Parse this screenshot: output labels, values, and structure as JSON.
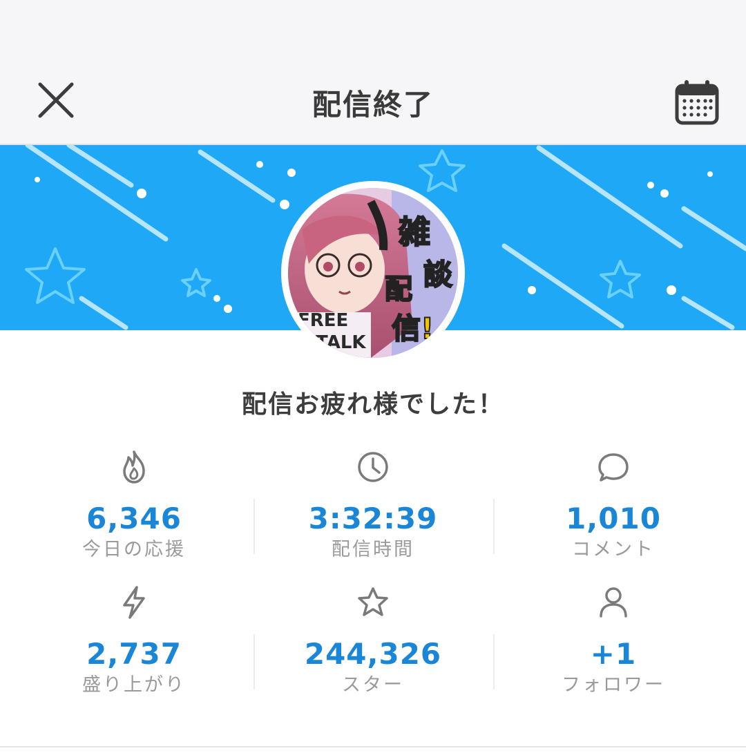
{
  "header": {
    "title": "配信終了",
    "close_icon": "close-icon",
    "calendar_icon": "calendar-icon"
  },
  "banner": {
    "color": "#1fa8f6",
    "avatar_text": {
      "top": "雑談",
      "middle": "配信!",
      "badge": "FREE TALK"
    }
  },
  "message": "配信お疲れ様でした！",
  "accent_color": "#1a86d8",
  "stats": [
    {
      "icon": "flame-icon",
      "value": "6,346",
      "label": "今日の応援"
    },
    {
      "icon": "clock-icon",
      "value": "3:32:39",
      "label": "配信時間"
    },
    {
      "icon": "comment-icon",
      "value": "1,010",
      "label": "コメント"
    },
    {
      "icon": "lightning-icon",
      "value": "2,737",
      "label": "盛り上がり"
    },
    {
      "icon": "star-icon",
      "value": "244,326",
      "label": "スター"
    },
    {
      "icon": "user-icon",
      "value": "+1",
      "label": "フォロワー"
    }
  ]
}
